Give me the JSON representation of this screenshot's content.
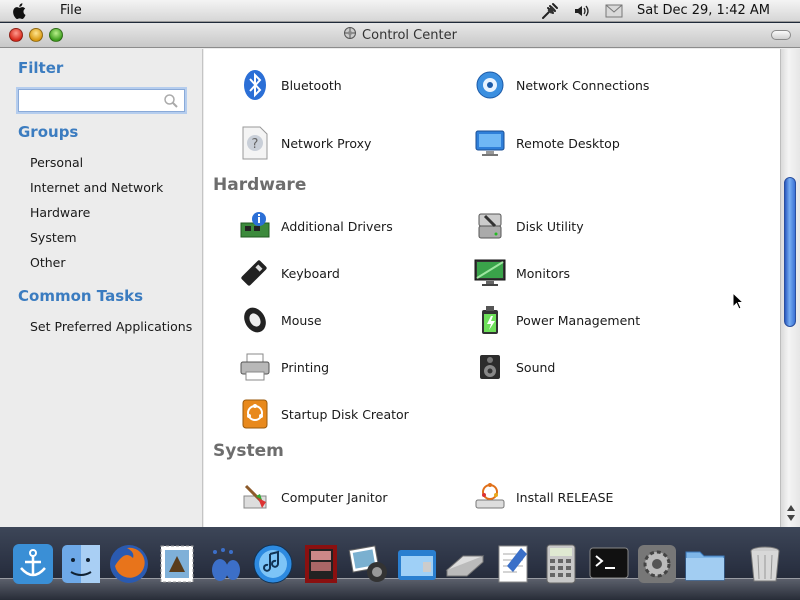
{
  "menubar": {
    "menu_file": "File",
    "clock": "Sat Dec 29,  1:42 AM"
  },
  "window": {
    "title": "Control Center"
  },
  "sidebar": {
    "filter_heading": "Filter",
    "search_placeholder": "",
    "groups_heading": "Groups",
    "groups": [
      "Personal",
      "Internet and Network",
      "Hardware",
      "System",
      "Other"
    ],
    "tasks_heading": "Common Tasks",
    "tasks": [
      "Set Preferred Applications"
    ]
  },
  "content": {
    "network_items": [
      {
        "label": "Bluetooth",
        "icon": "bluetooth-icon"
      },
      {
        "label": "Network Connections",
        "icon": "network-connections-icon"
      },
      {
        "label": "Network Proxy",
        "icon": "network-proxy-icon"
      },
      {
        "label": "Remote Desktop",
        "icon": "remote-desktop-icon"
      }
    ],
    "hardware_heading": "Hardware",
    "hardware_items": [
      {
        "label": "Additional Drivers",
        "icon": "additional-drivers-icon"
      },
      {
        "label": "Disk Utility",
        "icon": "disk-utility-icon"
      },
      {
        "label": "Keyboard",
        "icon": "keyboard-icon"
      },
      {
        "label": "Monitors",
        "icon": "monitors-icon"
      },
      {
        "label": "Mouse",
        "icon": "mouse-icon"
      },
      {
        "label": "Power Management",
        "icon": "power-management-icon"
      },
      {
        "label": "Printing",
        "icon": "printing-icon"
      },
      {
        "label": "Sound",
        "icon": "sound-icon"
      },
      {
        "label": "Startup Disk Creator",
        "icon": "startup-disk-creator-icon"
      }
    ],
    "system_heading": "System",
    "system_items": [
      {
        "label": "Computer Janitor",
        "icon": "computer-janitor-icon"
      },
      {
        "label": "Install RELEASE",
        "icon": "install-release-icon"
      }
    ]
  },
  "dock": {
    "items": [
      "anchor-icon",
      "finder-icon",
      "firefox-icon",
      "mail-stamp-icon",
      "paw-prints-icon",
      "itunes-icon",
      "photo-booth-icon",
      "iphoto-icon",
      "calendar-icon",
      "scanner-icon",
      "textedit-icon",
      "calculator-icon",
      "terminal-icon",
      "system-preferences-icon",
      "folder-icon",
      "trash-icon"
    ]
  },
  "colors": {
    "accent": "#3b7cc0",
    "section_heading": "#6d6d6d",
    "scroll_thumb": "#4a86e0"
  }
}
